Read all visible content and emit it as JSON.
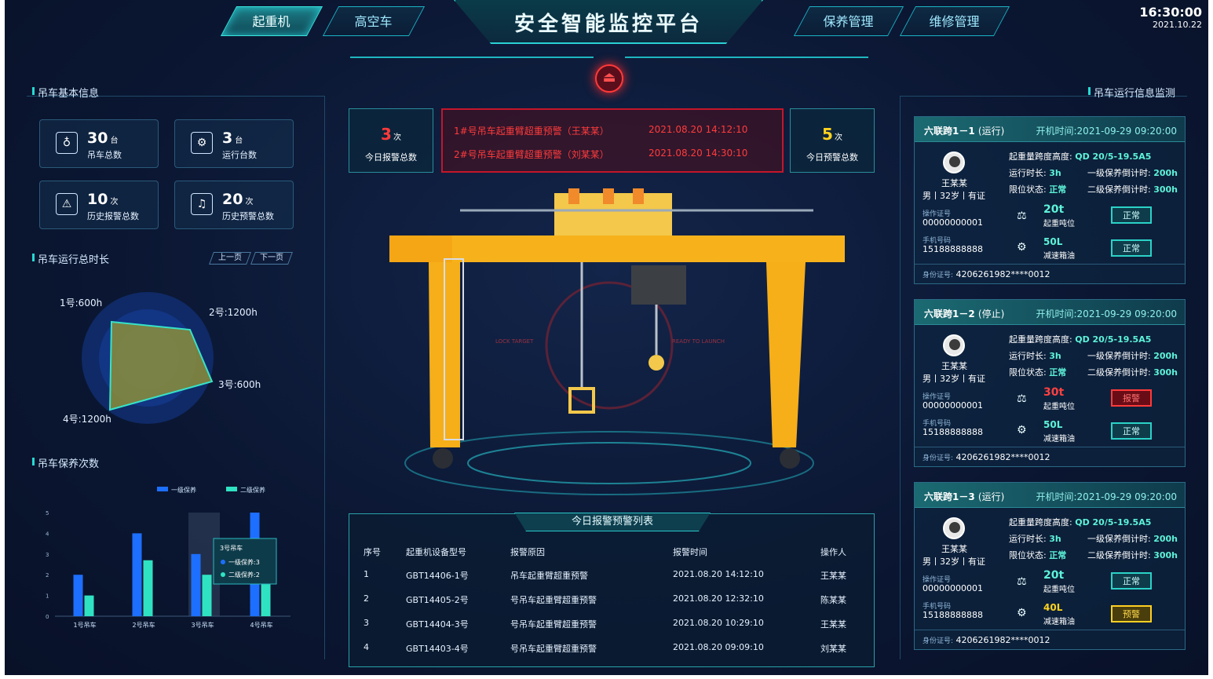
{
  "header": {
    "title": "安全智能监控平台",
    "nav": [
      "起重机",
      "高空车",
      "保养管理",
      "维修管理"
    ],
    "time": "16:30:00",
    "date": "2021.10.22"
  },
  "left": {
    "basic_title": "吊车基本信息",
    "cards": [
      {
        "num": "30",
        "unit": "台",
        "label": "吊车总数",
        "icon": "crane-hook-icon"
      },
      {
        "num": "3",
        "unit": "台",
        "label": "运行台数",
        "icon": "crane-running-icon"
      },
      {
        "num": "10",
        "unit": "次",
        "label": "历史报警总数",
        "icon": "alarm-siren-icon"
      },
      {
        "num": "20",
        "unit": "次",
        "label": "历史预警总数",
        "icon": "warning-bell-icon"
      }
    ],
    "runtime_title": "吊车运行总时长",
    "prev": "上一页",
    "next": "下一页",
    "radar_labels": [
      "1号:600h",
      "2号:1200h",
      "3号:600h",
      "4号:1200h"
    ],
    "maint_title": "吊车保养次数"
  },
  "chart_data": {
    "type": "bar",
    "categories": [
      "1号吊车",
      "2号吊车",
      "3号吊车",
      "4号吊车"
    ],
    "series": [
      {
        "name": "一级保养",
        "values": [
          2,
          4,
          3,
          5
        ],
        "color": "#1d6fff"
      },
      {
        "name": "二级保养",
        "values": [
          1,
          2.7,
          2,
          3
        ],
        "color": "#2fe3c2"
      }
    ],
    "ylim": [
      0,
      5
    ],
    "yticks": [
      "0",
      "1",
      "2",
      "3",
      "4",
      "5"
    ],
    "tooltip": {
      "title": "3号吊车",
      "rows": [
        "一级保养:3",
        "二级保养:2"
      ]
    }
  },
  "center": {
    "today_alarm": {
      "num": "3",
      "unit": "次",
      "label": "今日报警总数"
    },
    "today_warn": {
      "num": "5",
      "unit": "次",
      "label": "今日预警总数"
    },
    "alarms": [
      {
        "text": "1#号吊车起重臂超重预警（王某某）",
        "time": "2021.08.20 14:12:10"
      },
      {
        "text": "2#号吊车起重臂超重预警（刘某某）",
        "time": "2021.08.20 14:30:10"
      }
    ],
    "table_title": "今日报警预警列表",
    "headers": [
      "序号",
      "起重机设备型号",
      "报警原因",
      "报警时间",
      "操作人"
    ],
    "rows": [
      [
        "1",
        "GBT14406-1号",
        "吊车起重臂超重预警",
        "2021.08.20 14:12:10",
        "王某某"
      ],
      [
        "2",
        "GBT14405-2号",
        "号吊车起重臂超重预警",
        "2021.08.20 12:32:10",
        "陈某某"
      ],
      [
        "3",
        "GBT14404-3号",
        "号吊车起重臂超重预警",
        "2021.08.20 10:29:10",
        "王某某"
      ],
      [
        "4",
        "GBT14403-4号",
        "号吊车起重臂超重预警",
        "2021.08.20 09:09:10",
        "刘某某"
      ]
    ],
    "hud_left": "LOCK TARGET",
    "hud_right": "READY TO LAUNCH"
  },
  "right": {
    "title": "吊车运行信息监测",
    "cards": [
      {
        "name": "六联跨1－1",
        "status": "(运行)",
        "start": "开机时间:2021-09-29 09:20:00",
        "person": "王某某",
        "gender": "男丨32岁丨有证",
        "op_label": "操作证号",
        "op_no": "00000000001",
        "phone_label": "手机号码",
        "phone": "15188888888",
        "span_label": "起重量跨度高度:",
        "span": "QD 20/5-19.5A5",
        "run_label": "运行时长:",
        "run": "3h",
        "l1_label": "一级保养倒计时:",
        "l1": "200h",
        "limit_label": "限位状态:",
        "limit": "正常",
        "l2_label": "二级保养倒计时:",
        "l2": "300h",
        "load": "20t",
        "load_label": "起重吨位",
        "load_badge": "正常",
        "load_state": "ok",
        "oil": "50L",
        "oil_label": "减速箱油",
        "oil_badge": "正常",
        "oil_state": "ok",
        "id_label": "身份证号:",
        "id": "4206261982****0012"
      },
      {
        "name": "六联跨1－2",
        "status": "(停止)",
        "start": "开机时间:2021-09-29 09:20:00",
        "person": "王某某",
        "gender": "男丨32岁丨有证",
        "op_label": "操作证号",
        "op_no": "00000000001",
        "phone_label": "手机号码",
        "phone": "15188888888",
        "span_label": "起重量跨度高度:",
        "span": "QD 20/5-19.5A5",
        "run_label": "运行时长:",
        "run": "3h",
        "l1_label": "一级保养倒计时:",
        "l1": "200h",
        "limit_label": "限位状态:",
        "limit": "正常",
        "l2_label": "二级保养倒计时:",
        "l2": "300h",
        "load": "30t",
        "load_label": "起重吨位",
        "load_badge": "报警",
        "load_state": "alarm",
        "oil": "50L",
        "oil_label": "减速箱油",
        "oil_badge": "正常",
        "oil_state": "ok",
        "id_label": "身份证号:",
        "id": "4206261982****0012"
      },
      {
        "name": "六联跨1－3",
        "status": "(运行)",
        "start": "开机时间:2021-09-29 09:20:00",
        "person": "王某某",
        "gender": "男丨32岁丨有证",
        "op_label": "操作证号",
        "op_no": "00000000001",
        "phone_label": "手机号码",
        "phone": "15188888888",
        "span_label": "起重量跨度高度:",
        "span": "QD 20/5-19.5A5",
        "run_label": "运行时长:",
        "run": "3h",
        "l1_label": "一级保养倒计时:",
        "l1": "200h",
        "limit_label": "限位状态:",
        "limit": "正常",
        "l2_label": "二级保养倒计时:",
        "l2": "300h",
        "load": "20t",
        "load_label": "起重吨位",
        "load_badge": "正常",
        "load_state": "ok",
        "oil": "40L",
        "oil_label": "减速箱油",
        "oil_badge": "预警",
        "oil_state": "warn",
        "id_label": "身份证号:",
        "id": "4206261982****0012"
      }
    ]
  }
}
